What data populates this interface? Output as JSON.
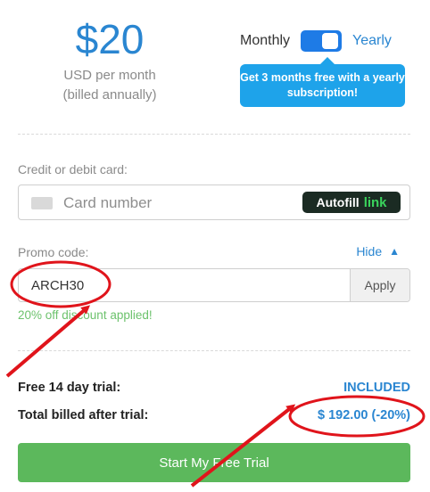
{
  "pricing": {
    "amount": "$20",
    "period": "USD per month",
    "billing_note": "(billed annually)"
  },
  "billing_toggle": {
    "monthly_label": "Monthly",
    "yearly_label": "Yearly",
    "selected": "Yearly",
    "promo_text": "Get 3 months free with a yearly subscription!"
  },
  "payment": {
    "label": "Credit or debit card:",
    "card_placeholder": "Card number",
    "autofill_label": "Autofill",
    "autofill_brand": "link"
  },
  "promo": {
    "label": "Promo code:",
    "hide_label": "Hide",
    "code_value": "ARCH30",
    "apply_label": "Apply",
    "discount_message": "20% off discount applied!"
  },
  "summary": {
    "trial_label": "Free 14 day trial:",
    "trial_value": "INCLUDED",
    "total_label": "Total billed after trial:",
    "total_value": "$ 192.00 (-20%)"
  },
  "cta": {
    "start_label": "Start My Free Trial"
  },
  "colors": {
    "accent": "#2a86d1",
    "toggle": "#1e7be6",
    "promo_bubble": "#1ea3ea",
    "success": "#6cc26c",
    "cta": "#5cb85c",
    "annotation": "#e0141b"
  }
}
